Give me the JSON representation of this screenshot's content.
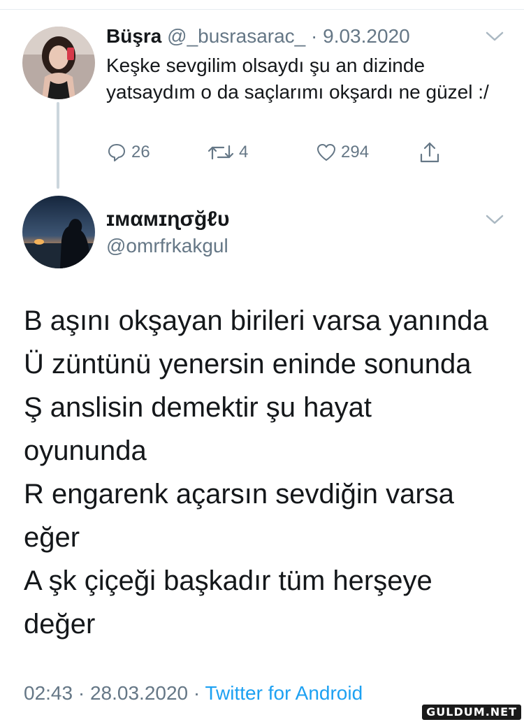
{
  "tweet1": {
    "display_name": "Büşra",
    "handle": "@_busrasarac_",
    "separator": " · ",
    "date": "9.03.2020",
    "text": "Keşke sevgilim olsaydı şu an dizinde yatsaydım o da saçlarımı okşardı ne güzel :/",
    "replies": "26",
    "retweets": "4",
    "likes": "294",
    "icons": [
      "avatar",
      "chevron-down-icon",
      "reply-icon",
      "retweet-icon",
      "like-icon",
      "share-icon"
    ]
  },
  "tweet2": {
    "display_name": "ɪмαмɪɳσğℓυ",
    "handle": "@omrfrkakgul",
    "lines": [
      "B aşını okşayan birileri varsa yanında",
      "Ü züntünü yenersin eninde sonunda",
      "Ş anslisin demektir şu hayat",
      "oyununda",
      "R engarenk açarsın sevdiğin varsa",
      "eğer",
      "A şk çiçeği başkadır tüm herşeye",
      "değer"
    ],
    "time": "02:43",
    "separator1": " · ",
    "date": "28.03.2020",
    "separator2": " · ",
    "source": "Twitter for Android"
  },
  "watermark": "GULDUM.NET",
  "colors": {
    "text": "#14171a",
    "secondary": "#657786",
    "link": "#1da1f2",
    "thread_line": "#ccd6dd"
  }
}
